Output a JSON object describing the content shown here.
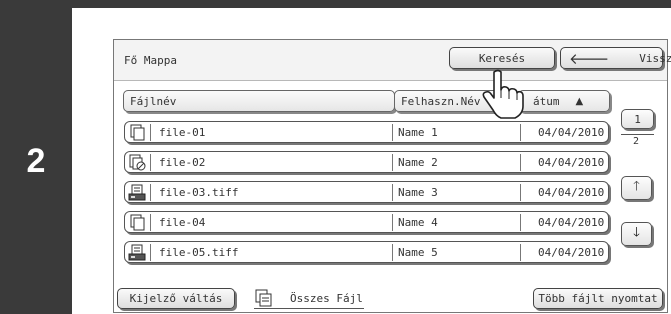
{
  "step_number": "2",
  "header": {
    "folder_title": "Fő Mappa",
    "search_label": "Keresés",
    "back_label": "Vissza"
  },
  "columns": {
    "file_name": "Fájlnév",
    "user_name": "Felhaszn.Név",
    "date": "átum"
  },
  "files": [
    {
      "name": "file-01",
      "user": "Name 1",
      "date": "04/04/2010",
      "icon": "copy-job-icon"
    },
    {
      "name": "file-02",
      "user": "Name 2",
      "date": "04/04/2010",
      "icon": "copy-protected-icon"
    },
    {
      "name": "file-03.tiff",
      "user": "Name 3",
      "date": "04/04/2010",
      "icon": "scan-tiff-icon"
    },
    {
      "name": "file-04",
      "user": "Name 4",
      "date": "04/04/2010",
      "icon": "copy-job-icon"
    },
    {
      "name": "file-05.tiff",
      "user": "Name 5",
      "date": "04/04/2010",
      "icon": "scan-tiff-icon"
    }
  ],
  "pagination": {
    "current": "1",
    "total": "2"
  },
  "footer": {
    "display_toggle_label": "Kijelző váltás",
    "all_files_label": "Összes Fájl",
    "print_multiple_label": "Több fájlt nyomtat"
  },
  "colors": {
    "dark_band": "#3a3a3a",
    "panel_border": "#777777"
  }
}
